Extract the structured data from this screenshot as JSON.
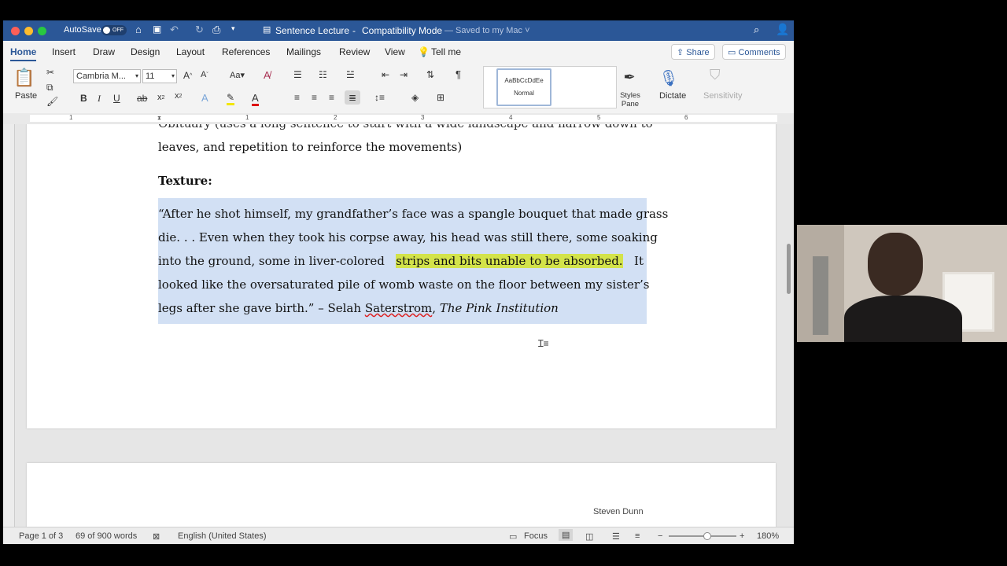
{
  "window": {
    "autosave_label": "AutoSave",
    "autosave_state": "OFF",
    "doc_title": "Sentence Lecture",
    "mode": "Compatibility Mode",
    "saved": "— Saved to my Mac ˅"
  },
  "tabs": [
    "Home",
    "Insert",
    "Draw",
    "Design",
    "Layout",
    "References",
    "Mailings",
    "Review",
    "View",
    "Tell me"
  ],
  "toolbar": {
    "share": "Share",
    "comments": "Comments",
    "paste": "Paste",
    "font": "Cambria M...",
    "font_size": "11",
    "style_preview": "AaBbCcDdEe",
    "style_name": "Normal",
    "styles_pane": "Styles\nPane",
    "dictate": "Dictate",
    "sensitivity": "Sensitivity"
  },
  "ruler": {
    "marks": [
      "1",
      "1",
      "2",
      "3",
      "4",
      "5",
      "6"
    ]
  },
  "document": {
    "line_prev1": "Obituary (uses a long sentence to start with a wide landscape and narrow down to",
    "line_prev2": "leaves, and repetition to reinforce the movements)",
    "heading": "Texture:",
    "p1": "“After he shot himself, my grandfather’s face was a spangle bouquet that made grass",
    "p2": "die. . . Even when they took his corpse away, his head was still there, some soaking",
    "p3a": "into the ground, some in liver-colored ",
    "p3b": "strips and bits unable to be absorbed.",
    "p3c": " It",
    "p4": "looked like the oversaturated pile of womb waste on the floor between my sister’s",
    "p5a": "legs after she gave birth.” – Selah ",
    "p5b": "Saterstrom",
    "p5c": ", ",
    "p5d": "The Pink Institution",
    "header_name": "Steven Dunn"
  },
  "status": {
    "page": "Page 1 of 3",
    "words": "69 of 900 words",
    "language": "English (United States)",
    "focus": "Focus",
    "zoom": "180%"
  },
  "colors": {
    "title_bar": "#2b5797",
    "selection": "#d2e0f4",
    "highlight": "#d3e34a"
  }
}
